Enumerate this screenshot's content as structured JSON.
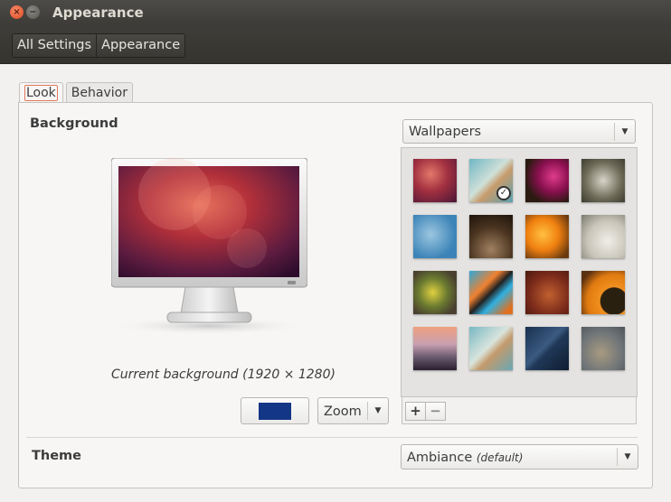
{
  "window": {
    "title": "Appearance"
  },
  "titlebar": {
    "close_glyph": "×",
    "minimize_glyph": "−"
  },
  "breadcrumb": {
    "items": [
      "All Settings",
      "Appearance"
    ]
  },
  "tabs": [
    {
      "label": "Look",
      "active": true
    },
    {
      "label": "Behavior",
      "active": false
    }
  ],
  "background": {
    "section_label": "Background",
    "source_select": {
      "value": "Wallpapers"
    },
    "caption": "Current background (1920 × 1280)",
    "color_swatch": "#133686",
    "mode_select": {
      "value": "Zoom"
    },
    "add_label": "+",
    "remove_label": "−",
    "wallpapers": [
      {
        "name": "warty-final-ubuntu",
        "selected": false
      },
      {
        "name": "teal-blur",
        "selected": true
      },
      {
        "name": "purple-flower",
        "selected": false
      },
      {
        "name": "dandelion-seeds",
        "selected": false
      },
      {
        "name": "blue-sky-birds",
        "selected": false
      },
      {
        "name": "brown-tunnel",
        "selected": false
      },
      {
        "name": "orange-lily",
        "selected": false
      },
      {
        "name": "clock-face",
        "selected": false
      },
      {
        "name": "yellow-flower",
        "selected": false
      },
      {
        "name": "graffiti",
        "selected": false
      },
      {
        "name": "red-leaf",
        "selected": false
      },
      {
        "name": "orange-ring",
        "selected": false
      },
      {
        "name": "city-sunset",
        "selected": false
      },
      {
        "name": "teal-blur-2",
        "selected": false
      },
      {
        "name": "blue-tiles",
        "selected": false
      },
      {
        "name": "grey-macro",
        "selected": false
      }
    ]
  },
  "theme": {
    "section_label": "Theme",
    "select": {
      "value": "Ambiance",
      "suffix": "(default)"
    }
  },
  "icons": {
    "dropdown": "chevron-down-icon",
    "selected": "check-icon"
  }
}
